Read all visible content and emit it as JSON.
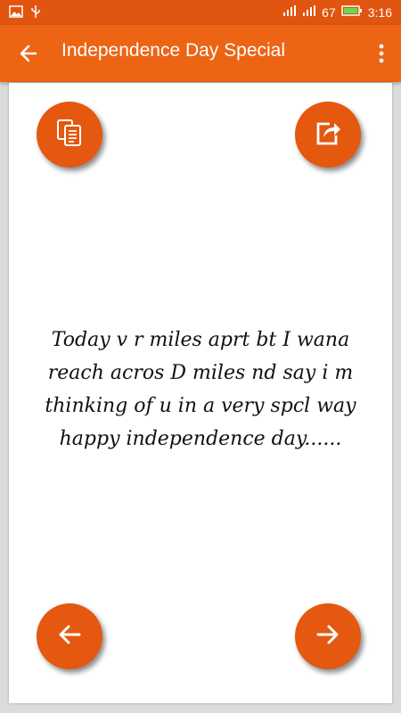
{
  "status_bar": {
    "battery_level": "67",
    "time": "3:16",
    "icons": [
      "image-icon",
      "usb-icon",
      "signal-icon",
      "signal-icon",
      "battery-icon"
    ]
  },
  "app_bar": {
    "title": "Independence Day Special",
    "icons": [
      "back-arrow-icon",
      "overflow-menu-icon"
    ],
    "color": "#ec6414"
  },
  "message": {
    "lines": [
      "Today v r miles aprt bt I wana",
      "reach acros D miles nd say i m",
      "thinking of u in a very spcl way",
      "happy independence day......"
    ]
  },
  "actions": {
    "icons": [
      "copy-icon",
      "share-icon",
      "arrow-left-icon",
      "arrow-right-icon"
    ],
    "button_color": "#e4580f"
  }
}
